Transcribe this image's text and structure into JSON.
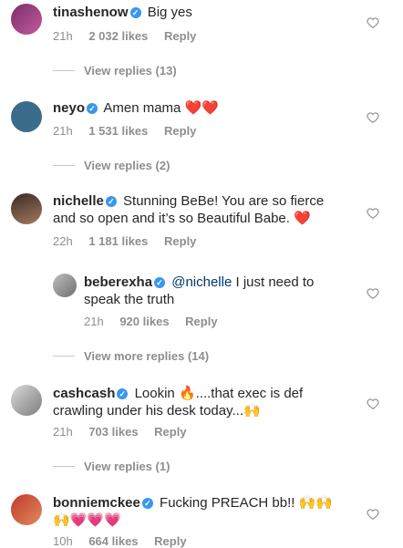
{
  "comments": [
    {
      "username": "tinashenow",
      "text": "Big yes",
      "time": "21h",
      "likes": "2 032 likes",
      "reply": "Reply"
    },
    {
      "username": "neyo",
      "text": "Amen mama",
      "emoji": "❤️❤️",
      "time": "21h",
      "likes": "1 531 likes",
      "reply": "Reply",
      "view_replies": "View replies (2)"
    },
    {
      "username": "nichelle",
      "text": "Stunning BeBe! You are so fierce",
      "text2": "and so open and it’s so Beautiful Babe.",
      "emoji": "❤️",
      "time": "22h",
      "likes": "1 181 likes",
      "reply": "Reply"
    },
    {
      "username": "beberexha",
      "mention": "@nichelle",
      "text": "I just need to",
      "text2": "speak the truth",
      "time": "21h",
      "likes": "920 likes",
      "reply": "Reply",
      "view_more": "View more replies (14)"
    },
    {
      "username": "cashcash",
      "text": "Lookin",
      "emoji": "🔥",
      "text_after": "....that exec is def",
      "text2": "crawling under his desk today...",
      "emoji2": "🙌",
      "time": "21h",
      "likes": "703 likes",
      "reply": "Reply",
      "view_replies": "View replies (1)"
    },
    {
      "username": "bonniemckee",
      "text": "Fucking PREACH bb!!",
      "emoji": "🙌🙌",
      "emoji2": "🙌💗💗💗",
      "time": "10h",
      "likes": "664 likes",
      "reply": "Reply"
    }
  ],
  "top_view_replies": "View replies (13)"
}
